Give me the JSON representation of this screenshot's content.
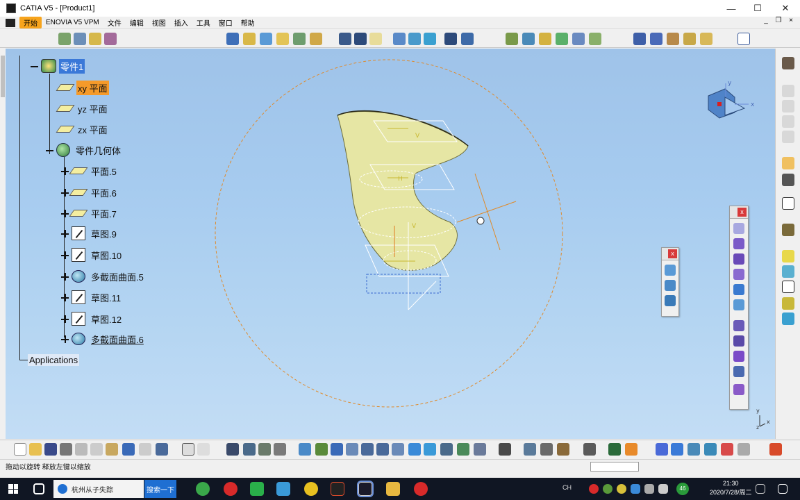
{
  "window": {
    "title": "CATIA V5 - [Product1]",
    "minimize": "—",
    "maximize": "☐",
    "close": "✕"
  },
  "menu": {
    "items": [
      "开始",
      "ENOVIA V5 VPM",
      "文件",
      "编辑",
      "视图",
      "插入",
      "工具",
      "窗口",
      "帮助"
    ],
    "mdi": [
      "_",
      "❐",
      "×"
    ]
  },
  "tree": {
    "root_label": "零件1",
    "nodes": [
      {
        "label": "xy 平面",
        "icon": "plane-icon"
      },
      {
        "label": "yz 平面",
        "icon": "plane-icon"
      },
      {
        "label": "zx 平面",
        "icon": "plane-icon"
      },
      {
        "label": "零件几何体",
        "icon": "part-body-icon"
      },
      {
        "label": "平面.5",
        "icon": "plane-icon"
      },
      {
        "label": "平面.6",
        "icon": "plane-icon"
      },
      {
        "label": "平面.7",
        "icon": "plane-icon"
      },
      {
        "label": "草图.9",
        "icon": "sketch-icon"
      },
      {
        "label": "草图.10",
        "icon": "sketch-icon"
      },
      {
        "label": "多截面曲面.5",
        "icon": "multisection-surface-icon"
      },
      {
        "label": "草图.11",
        "icon": "sketch-icon"
      },
      {
        "label": "草图.12",
        "icon": "sketch-icon"
      },
      {
        "label": "多截面曲面.6",
        "icon": "multisection-surface-icon"
      }
    ],
    "applications_label": "Applications"
  },
  "viewport": {
    "compass_axes": [
      "x",
      "y"
    ],
    "corner_axes": [
      "y",
      "z",
      "x"
    ],
    "plane_labels": [
      "H",
      "V"
    ]
  },
  "floating_toolbars": {
    "small_close": "x",
    "large_close": "x"
  },
  "statusbar": {
    "text": "拖动以旋转 释放左键以缩放"
  },
  "taskbar": {
    "browser_tab": "杭州从子失踪",
    "search_button": "搜索一下",
    "time": "21:30",
    "date": "2020/7/28/周二",
    "tray_text": "CH",
    "badge": "46"
  },
  "colors": {
    "viewport_top": "#9fc3e9",
    "viewport_bottom": "#c3ddf5",
    "surface": "#e6e6a4",
    "selection_blue": "#3a78d8",
    "selection_orange": "#f59a2a",
    "sphere_orange": "#e08a2a"
  }
}
